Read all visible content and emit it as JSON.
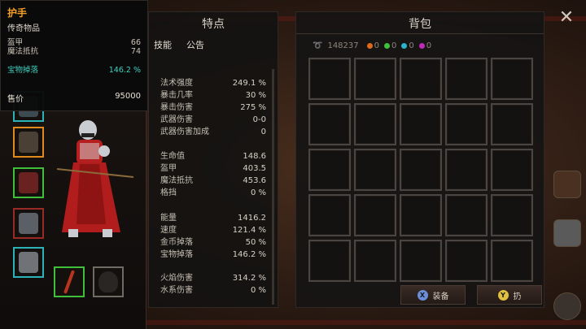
{
  "tooltip": {
    "title": "护手",
    "rarity": "传奇物品",
    "stats": [
      {
        "label": "盔甲",
        "value": "66"
      },
      {
        "label": "魔法抵抗",
        "value": "74"
      }
    ],
    "bonus": {
      "label": "宝物掉落",
      "value": "146.2 %"
    },
    "price": {
      "label": "售价",
      "value": "95000"
    }
  },
  "stats_panel": {
    "title": "特点",
    "tabs": [
      "技能",
      "公告"
    ],
    "groups": [
      [
        {
          "label": "法术强度",
          "value": "249.1 %"
        },
        {
          "label": "暴击几率",
          "value": "30 %"
        },
        {
          "label": "暴击伤害",
          "value": "275 %"
        },
        {
          "label": "武器伤害",
          "value": "0-0"
        },
        {
          "label": "武器伤害加成",
          "value": "0"
        }
      ],
      [
        {
          "label": "生命值",
          "value": "148.6"
        },
        {
          "label": "盔甲",
          "value": "403.5"
        },
        {
          "label": "魔法抵抗",
          "value": "453.6"
        },
        {
          "label": "格挡",
          "value": "0 %"
        }
      ],
      [
        {
          "label": "能量",
          "value": "1416.2"
        },
        {
          "label": "速度",
          "value": "121.4 %"
        },
        {
          "label": "金币掉落",
          "value": "50 %"
        },
        {
          "label": "宝物掉落",
          "value": "146.2 %"
        }
      ],
      [
        {
          "label": "火焰伤害",
          "value": "314.2 %"
        },
        {
          "label": "水系伤害",
          "value": "0 %"
        }
      ]
    ]
  },
  "bag": {
    "title": "背包",
    "gold": "148237",
    "gems": [
      {
        "color": "#e06a1c",
        "value": "0"
      },
      {
        "color": "#3fbf3a",
        "value": "0"
      },
      {
        "color": "#2bb3c8",
        "value": "0"
      },
      {
        "color": "#c02ab8",
        "value": "0"
      }
    ],
    "equip_button": {
      "key": "X",
      "label": "装备",
      "key_color": "#6a8fd8"
    },
    "drop_button": {
      "key": "Y",
      "label": "扔",
      "key_color": "#e0c040"
    }
  },
  "close_label": "✕"
}
